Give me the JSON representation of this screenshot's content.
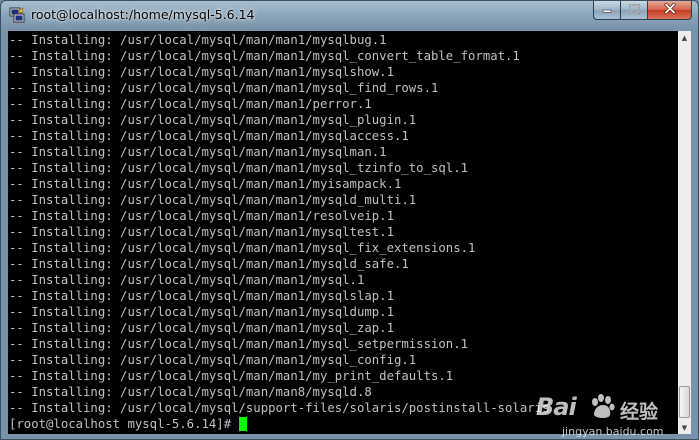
{
  "window": {
    "title": "root@localhost:/home/mysql-5.6.14",
    "buttons": {
      "minimize": "minimize-icon",
      "maximize": "maximize-icon",
      "close": "close-icon"
    }
  },
  "terminal": {
    "lines": [
      "-- Installing: /usr/local/mysql/man/man1/mysqlbug.1",
      "-- Installing: /usr/local/mysql/man/man1/mysql_convert_table_format.1",
      "-- Installing: /usr/local/mysql/man/man1/mysqlshow.1",
      "-- Installing: /usr/local/mysql/man/man1/mysql_find_rows.1",
      "-- Installing: /usr/local/mysql/man/man1/perror.1",
      "-- Installing: /usr/local/mysql/man/man1/mysql_plugin.1",
      "-- Installing: /usr/local/mysql/man/man1/mysqlaccess.1",
      "-- Installing: /usr/local/mysql/man/man1/mysqlman.1",
      "-- Installing: /usr/local/mysql/man/man1/mysql_tzinfo_to_sql.1",
      "-- Installing: /usr/local/mysql/man/man1/myisampack.1",
      "-- Installing: /usr/local/mysql/man/man1/mysqld_multi.1",
      "-- Installing: /usr/local/mysql/man/man1/resolveip.1",
      "-- Installing: /usr/local/mysql/man/man1/mysqltest.1",
      "-- Installing: /usr/local/mysql/man/man1/mysql_fix_extensions.1",
      "-- Installing: /usr/local/mysql/man/man1/mysqld_safe.1",
      "-- Installing: /usr/local/mysql/man/man1/mysql.1",
      "-- Installing: /usr/local/mysql/man/man1/mysqlslap.1",
      "-- Installing: /usr/local/mysql/man/man1/mysqldump.1",
      "-- Installing: /usr/local/mysql/man/man1/mysql_zap.1",
      "-- Installing: /usr/local/mysql/man/man1/mysql_setpermission.1",
      "-- Installing: /usr/local/mysql/man/man1/mysql_config.1",
      "-- Installing: /usr/local/mysql/man/man1/my_print_defaults.1",
      "-- Installing: /usr/local/mysql/man/man8/mysqld.8",
      "-- Installing: /usr/local/mysql/support-files/solaris/postinstall-solaris"
    ],
    "prompt": "[root@localhost mysql-5.6.14]# ",
    "cursor_color": "#00ff00",
    "text_color": "#c0c0c0",
    "background": "#000000"
  },
  "watermark": {
    "logo_text": "Bai",
    "paw": "paw-icon",
    "suffix": "经验",
    "url": "jingyan.baidu.com"
  }
}
